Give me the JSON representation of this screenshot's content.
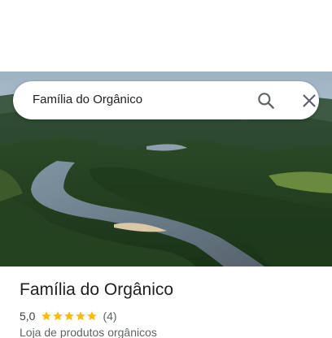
{
  "search": {
    "query": "Família do Orgânico"
  },
  "place": {
    "name": "Família do Orgânico",
    "rating": "5,0",
    "stars": 5,
    "review_count": "(4)",
    "category": "Loja de produtos orgânicos"
  },
  "colors": {
    "star": "#FBBC04",
    "text_primary": "#202124",
    "text_secondary": "#5F6368"
  },
  "icons": {
    "search": "search-icon",
    "close": "close-icon",
    "star": "star-icon"
  }
}
